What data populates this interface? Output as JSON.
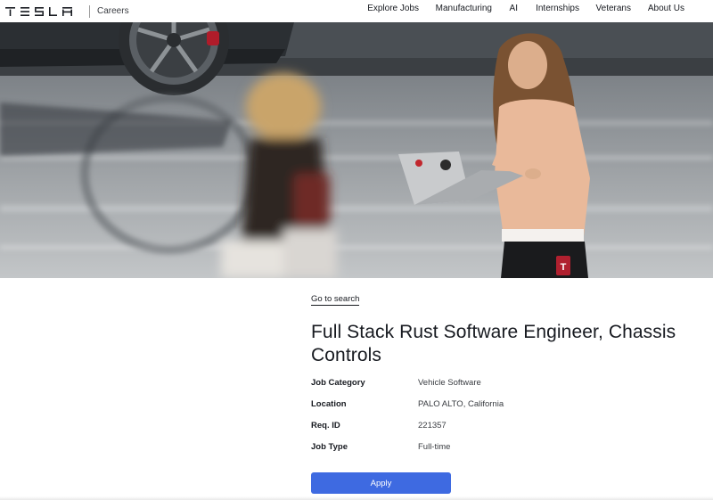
{
  "header": {
    "logo_text": "TESLA",
    "section": "Careers",
    "nav": [
      {
        "label": "Explore Jobs"
      },
      {
        "label": "Manufacturing"
      },
      {
        "label": "AI"
      },
      {
        "label": "Internships"
      },
      {
        "label": "Veterans"
      },
      {
        "label": "About Us"
      }
    ]
  },
  "hero": {
    "badge_letter": "T"
  },
  "job": {
    "back_link": "Go to search",
    "title": "Full Stack Rust Software Engineer, Chassis Controls",
    "fields": [
      {
        "label": "Job Category",
        "value": "Vehicle Software"
      },
      {
        "label": "Location",
        "value": "PALO ALTO, California"
      },
      {
        "label": "Req. ID",
        "value": "221357"
      },
      {
        "label": "Job Type",
        "value": "Full-time"
      }
    ],
    "apply_label": "Apply"
  },
  "colors": {
    "accent": "#3e6ae1",
    "text": "#171a20",
    "muted": "#393c41"
  }
}
